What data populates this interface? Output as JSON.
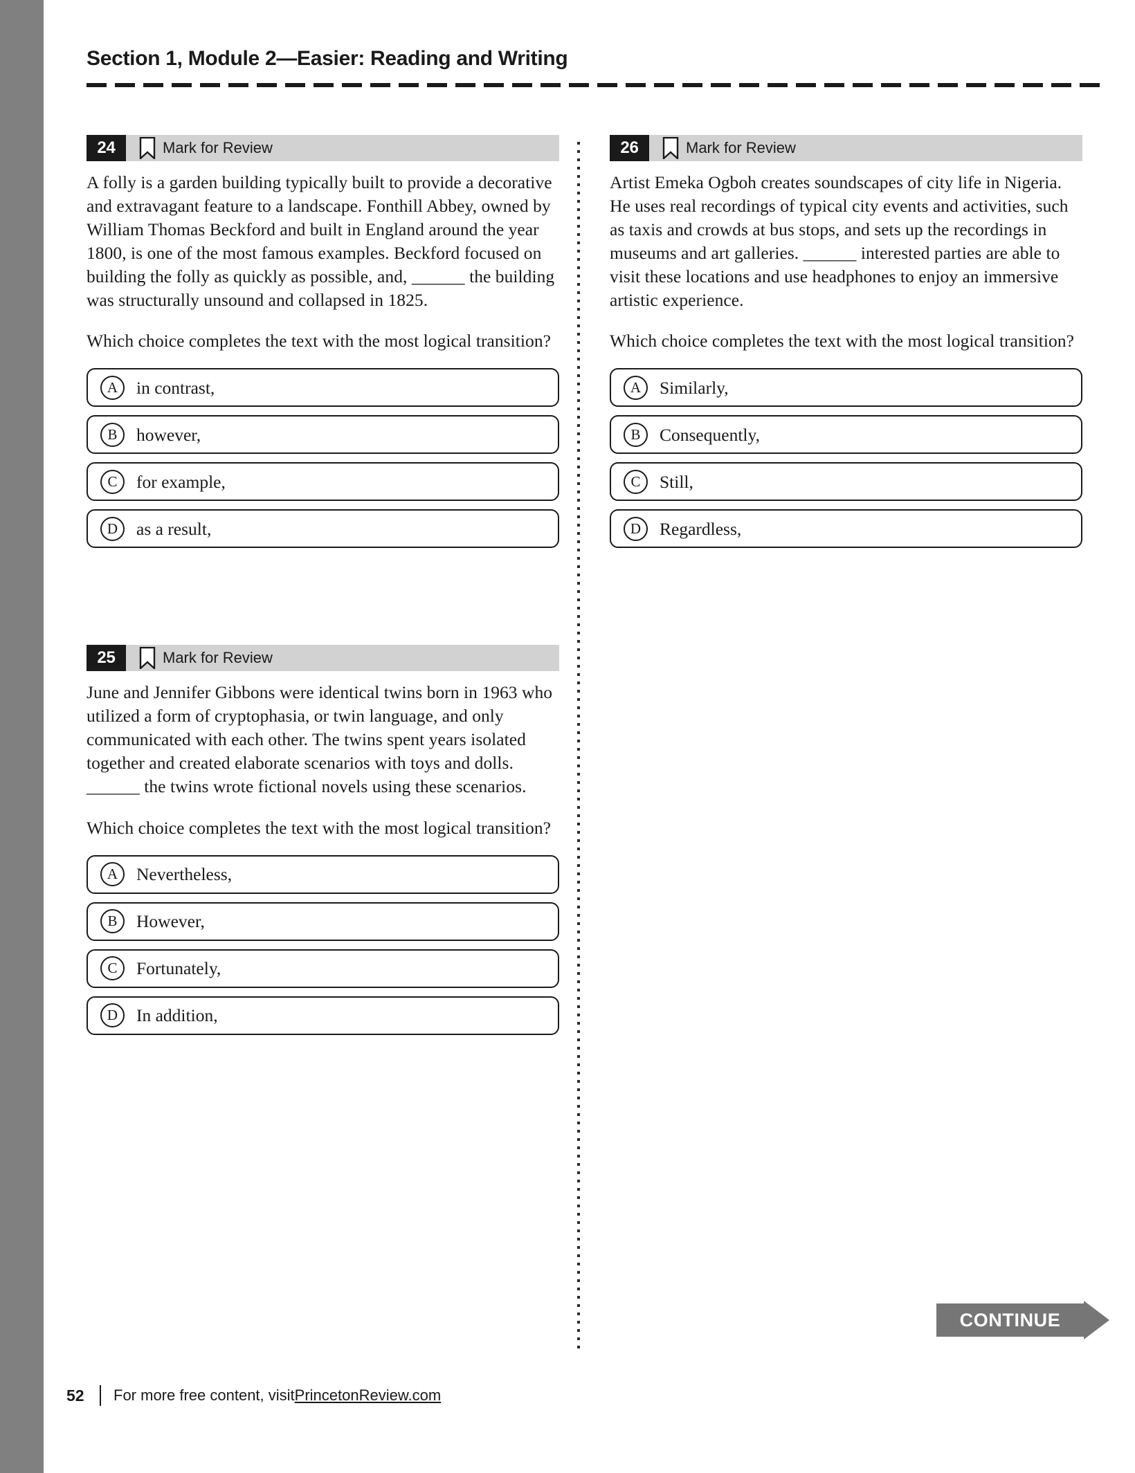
{
  "header": {
    "title": "Section 1, Module 2—Easier: Reading and Writing"
  },
  "mark_for_review_label": "Mark for Review",
  "questions": [
    {
      "number": "24",
      "column": "left",
      "passage": "A folly is a garden building typically built to provide a decorative and extravagant feature to a landscape. Fonthill Abbey, owned by William Thomas Beckford and built in England around the year 1800, is one of the most famous examples. Beckford focused on building the folly as quickly as possible, and, ______ the building was structurally unsound and collapsed in 1825.",
      "prompt": "Which choice completes the text with the most logical transition?",
      "choices": [
        {
          "letter": "A",
          "text": "in contrast,"
        },
        {
          "letter": "B",
          "text": "however,"
        },
        {
          "letter": "C",
          "text": "for example,"
        },
        {
          "letter": "D",
          "text": "as a result,"
        }
      ]
    },
    {
      "number": "25",
      "column": "left",
      "passage": "June and Jennifer Gibbons were identical twins born in 1963 who utilized a form of cryptophasia, or twin language, and only communicated with each other. The twins spent years isolated together and created elaborate scenarios with toys and dolls. ______ the twins wrote fictional novels using these scenarios.",
      "prompt": "Which choice completes the text with the most logical transition?",
      "choices": [
        {
          "letter": "A",
          "text": "Nevertheless,"
        },
        {
          "letter": "B",
          "text": "However,"
        },
        {
          "letter": "C",
          "text": "Fortunately,"
        },
        {
          "letter": "D",
          "text": "In addition,"
        }
      ]
    },
    {
      "number": "26",
      "column": "right",
      "passage": "Artist Emeka Ogboh creates soundscapes of city life in Nigeria. He uses real recordings of typical city events and activities, such as taxis and crowds at bus stops, and sets up the recordings in museums and art galleries. ______ interested parties are able to visit these locations and use headphones to enjoy an immersive artistic experience.",
      "prompt": "Which choice completes the text with the most logical transition?",
      "choices": [
        {
          "letter": "A",
          "text": "Similarly,"
        },
        {
          "letter": "B",
          "text": "Consequently,"
        },
        {
          "letter": "C",
          "text": "Still,"
        },
        {
          "letter": "D",
          "text": "Regardless,"
        }
      ]
    }
  ],
  "continue_button": {
    "label": "CONTINUE"
  },
  "footer": {
    "page_number": "52",
    "text": "For more free content, visit ",
    "link": "PrincetonReview.com"
  },
  "colors": {
    "spine_gray": "#808080",
    "headbar_gray": "#d2d2d2",
    "number_black": "#1a1a1a",
    "continue_gray": "#767676"
  }
}
